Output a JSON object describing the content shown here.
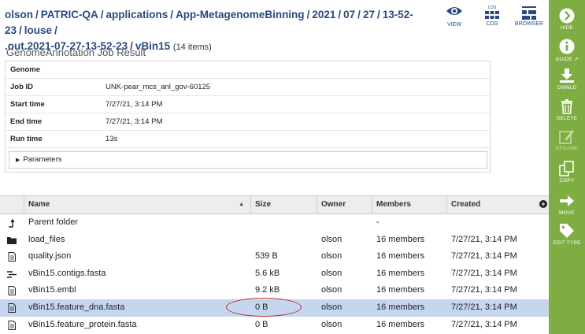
{
  "breadcrumb": {
    "parts": [
      "olson",
      "PATRIC-QA",
      "applications",
      "App-MetagenomeBinning",
      "2021",
      "07",
      "27",
      "13-52-23",
      "louse",
      ".out.2021-07-27-13-52-23"
    ],
    "current": "vBin15",
    "count": "(14 items)"
  },
  "top_actions": [
    {
      "label": "VIEW",
      "icon": "eye-icon"
    },
    {
      "label": "CDS",
      "icon": "cds-icon"
    },
    {
      "label": "BROWSER",
      "icon": "browser-icon"
    }
  ],
  "job": {
    "title": "GenomeAnnotation Job Result",
    "rows": [
      {
        "key": "Genome",
        "value": ""
      },
      {
        "key": "Job ID",
        "value": "UNK-pear_mcs_anl_gov-60125"
      },
      {
        "key": "Start time",
        "value": "7/27/21, 3:14 PM"
      },
      {
        "key": "End time",
        "value": "7/27/21, 3:14 PM"
      },
      {
        "key": "Run time",
        "value": "13s"
      }
    ],
    "parameters_label": "Parameters"
  },
  "grid": {
    "columns": [
      "Name",
      "Size",
      "Owner",
      "Members",
      "Created"
    ],
    "sort_indicator": "▲",
    "rows": [
      {
        "icon": "parent-folder-icon",
        "name": "Parent folder",
        "size": "",
        "owner": "",
        "members": "-",
        "created": "",
        "selected": false
      },
      {
        "icon": "folder-icon",
        "name": "load_files",
        "size": "",
        "owner": "olson",
        "members": "16 members",
        "created": "7/27/21, 3:14 PM",
        "selected": false
      },
      {
        "icon": "file-icon",
        "name": "quality.json",
        "size": "539 B",
        "owner": "olson",
        "members": "16 members",
        "created": "7/27/21, 3:14 PM",
        "selected": false
      },
      {
        "icon": "contigs-icon",
        "name": "vBin15.contigs.fasta",
        "size": "5.6 kB",
        "owner": "olson",
        "members": "16 members",
        "created": "7/27/21, 3:14 PM",
        "selected": false
      },
      {
        "icon": "file-icon",
        "name": "vBin15.embl",
        "size": "9.2 kB",
        "owner": "olson",
        "members": "16 members",
        "created": "7/27/21, 3:14 PM",
        "selected": false
      },
      {
        "icon": "file-icon",
        "name": "vBin15.feature_dna.fasta",
        "size": "0 B",
        "owner": "olson",
        "members": "16 members",
        "created": "7/27/21, 3:14 PM",
        "selected": true
      },
      {
        "icon": "file-icon",
        "name": "vBin15.feature_protein.fasta",
        "size": "0 B",
        "owner": "olson",
        "members": "16 members",
        "created": "7/27/21, 3:14 PM",
        "selected": false
      }
    ]
  },
  "side_actions": [
    {
      "label": "HIDE",
      "icon": "hide-icon",
      "enabled": true
    },
    {
      "label": "GUIDE",
      "icon": "info-icon",
      "enabled": true
    },
    {
      "label": "DWNLD",
      "icon": "download-icon",
      "enabled": true
    },
    {
      "label": "DELETE",
      "icon": "trash-icon",
      "enabled": true
    },
    {
      "label": "RENAME",
      "icon": "edit-icon",
      "enabled": false
    },
    {
      "label": "COPY",
      "icon": "copy-icon",
      "enabled": true
    },
    {
      "label": "MOVE",
      "icon": "move-icon",
      "enabled": true
    },
    {
      "label": "EDIT TYPE",
      "icon": "tag-icon",
      "enabled": true
    }
  ],
  "colors": {
    "accent": "#7ead42",
    "link": "#2a4a7f",
    "selected_row": "#c5d7ef",
    "highlight_oval": "#c0282a"
  }
}
